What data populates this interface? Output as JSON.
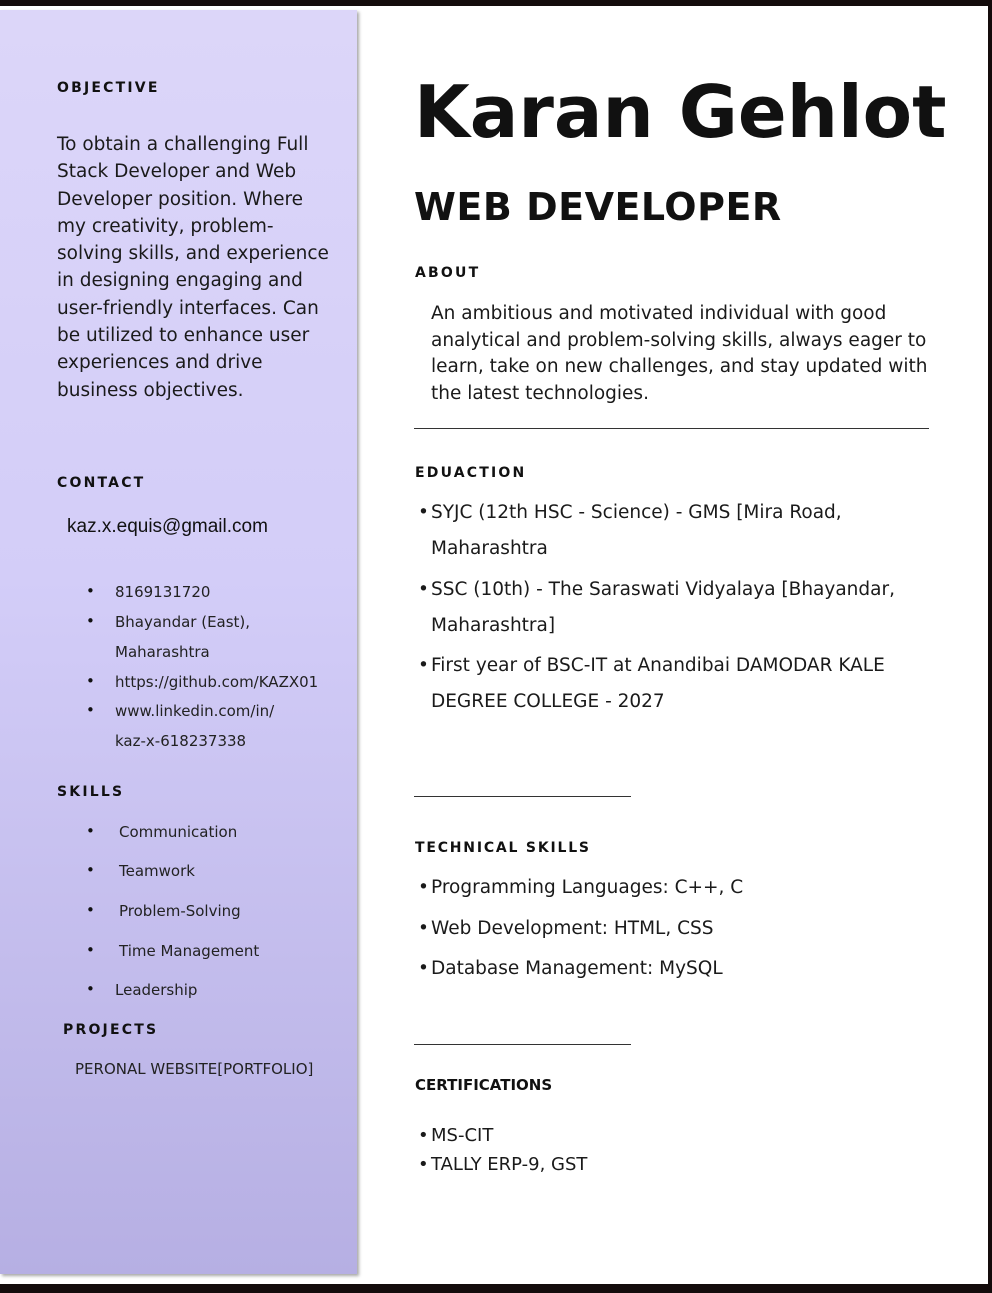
{
  "sidebar": {
    "objective": {
      "heading": "OBJECTIVE",
      "text": "To obtain a challenging Full Stack Developer and Web Developer position. Where my creativity, problem-solving skills, and experience in designing engaging and user-friendly interfaces. Can be utilized to enhance user experiences and drive business objectives."
    },
    "contact": {
      "heading": "CONTACT",
      "email": "kaz.x.equis@gmail.com",
      "phone": "8169131720",
      "address_1": "Bhayandar (East),",
      "address_2": "Maharashtra",
      "github": "https://github.com/KAZX01",
      "linkedin_1": "www.linkedin.com/in/",
      "linkedin_2": "kaz-x-618237338"
    },
    "skills": {
      "heading": "SKILLS",
      "items": [
        "Communication",
        "Teamwork",
        "Problem-Solving",
        "Time Management",
        "Leadership"
      ]
    },
    "projects": {
      "heading": "PROJECTS",
      "items": [
        "PERONAL WEBSITE[PORTFOLIO]"
      ]
    }
  },
  "main": {
    "name": "Karan Gehlot",
    "title": "WEB DEVELOPER",
    "about": {
      "heading": "ABOUT",
      "text": "An ambitious and motivated individual with good analytical and problem-solving skills, always eager to learn, take on new challenges, and stay updated with the latest technologies."
    },
    "education": {
      "heading": "EDUACTION",
      "items": [
        [
          "SYJC (12th HSC - Science) - GMS [Mira Road,",
          "Maharashtra"
        ],
        [
          "SSC (10th) - The Saraswati Vidyalaya [Bhayandar,",
          "Maharashtra]"
        ],
        [
          "First year of BSC-IT at Anandibai DAMODAR KALE",
          "DEGREE COLLEGE - 2027"
        ]
      ]
    },
    "technical_skills": {
      "heading": "TECHNICAL SKILLS",
      "items": [
        "Programming Languages:  C++, C",
        "Web Development: HTML, CSS",
        "Database Management: MySQL"
      ]
    },
    "certifications": {
      "heading": "CERTIFICATIONS",
      "items": [
        "MS-CIT",
        "TALLY ERP-9, GST"
      ]
    }
  }
}
